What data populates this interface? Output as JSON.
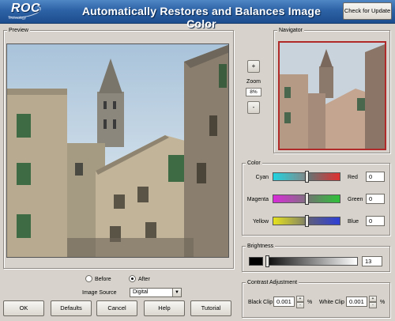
{
  "header": {
    "logo_text": "ROC",
    "logo_subtext": "Technology",
    "title": "Automatically Restores and Balances Image Color",
    "update_button": "Check for Update"
  },
  "preview": {
    "title": "Preview"
  },
  "zoom": {
    "plus": "+",
    "label": "Zoom",
    "value": "8%",
    "minus": "-"
  },
  "navigator": {
    "title": "Navigator"
  },
  "color": {
    "title": "Color",
    "rows": [
      {
        "left": "Cyan",
        "right": "Red",
        "value": "0",
        "left_color": "#21d3e0",
        "right_color": "#e03030"
      },
      {
        "left": "Magenta",
        "right": "Green",
        "value": "0",
        "left_color": "#d92bd9",
        "right_color": "#2fc23a"
      },
      {
        "left": "Yellow",
        "right": "Blue",
        "value": "0",
        "left_color": "#e6e21e",
        "right_color": "#2d3fd6"
      }
    ]
  },
  "brightness": {
    "title": "Brightness",
    "value": "13"
  },
  "contrast": {
    "title": "Contrast Adjustment",
    "black_clip_label": "Black Clip",
    "black_clip_value": "0.001",
    "white_clip_label": "White Clip",
    "white_clip_value": "0.001",
    "unit": "%"
  },
  "view_mode": {
    "before": "Before",
    "after": "After",
    "selected": "After"
  },
  "image_source": {
    "label": "Image Source",
    "value": "Digital"
  },
  "buttons": {
    "ok": "OK",
    "defaults": "Defaults",
    "cancel": "Cancel",
    "help": "Help",
    "tutorial": "Tutorial"
  }
}
